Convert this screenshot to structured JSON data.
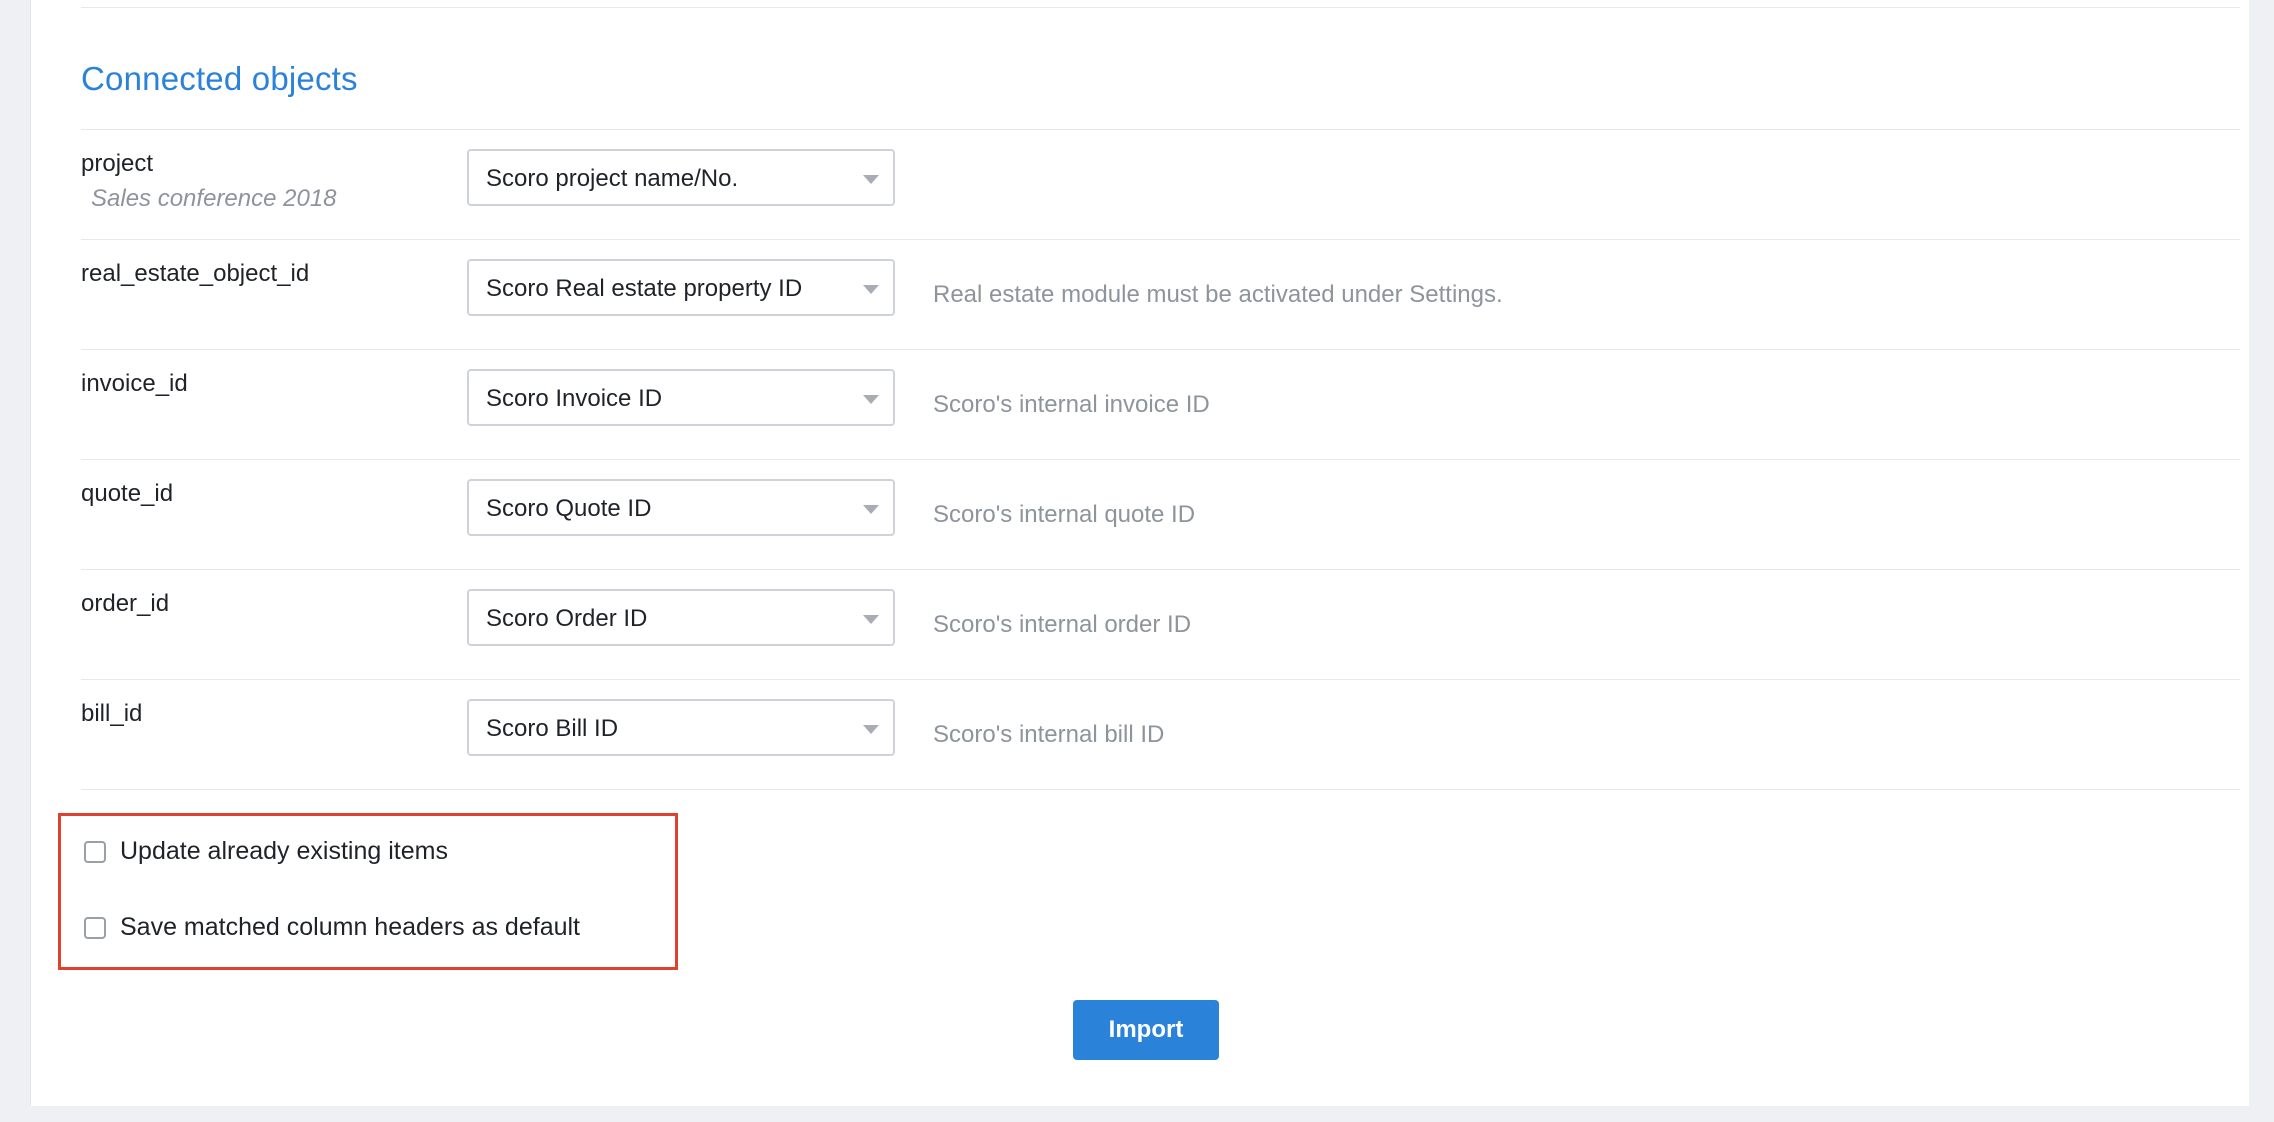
{
  "section": {
    "title": "Connected objects"
  },
  "rows": [
    {
      "name": "project",
      "sub": "Sales conference 2018",
      "select_value": "Scoro project name/No.",
      "hint": ""
    },
    {
      "name": "real_estate_object_id",
      "sub": "",
      "select_value": "Scoro Real estate property ID",
      "hint": "Real estate module must be activated under Settings."
    },
    {
      "name": "invoice_id",
      "sub": "",
      "select_value": "Scoro Invoice ID",
      "hint": "Scoro's internal invoice ID"
    },
    {
      "name": "quote_id",
      "sub": "",
      "select_value": "Scoro Quote ID",
      "hint": "Scoro's internal quote ID"
    },
    {
      "name": "order_id",
      "sub": "",
      "select_value": "Scoro Order ID",
      "hint": "Scoro's internal order ID"
    },
    {
      "name": "bill_id",
      "sub": "",
      "select_value": "Scoro Bill ID",
      "hint": "Scoro's internal bill ID"
    }
  ],
  "options": {
    "update_existing": {
      "label": "Update already existing items",
      "checked": false
    },
    "save_headers": {
      "label": "Save matched column headers as default",
      "checked": false
    }
  },
  "actions": {
    "import_label": "Import"
  },
  "colors": {
    "accent": "#2b82d9",
    "highlight_border": "#e0412d",
    "muted_text": "#8e949c"
  }
}
